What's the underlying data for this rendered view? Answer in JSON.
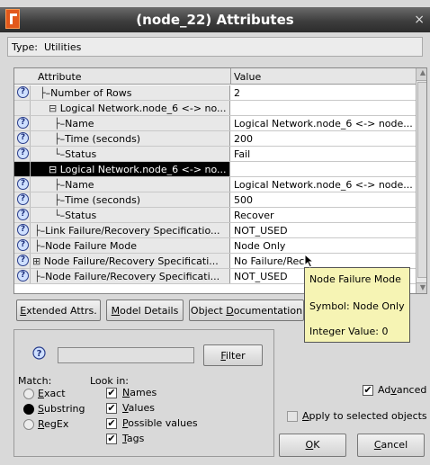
{
  "window": {
    "title": "(node_22) Attributes",
    "close": "×"
  },
  "typebar": {
    "label": "Type:",
    "value": "Utilities"
  },
  "table": {
    "headers": {
      "attribute": "Attribute",
      "value": "Value"
    },
    "rows": [
      {
        "attr": "Number of Rows",
        "prefix": "├",
        "value": "2"
      },
      {
        "attr": "Logical Network.node_6 <-> no...",
        "prefix": "⊟",
        "value": ""
      },
      {
        "attr": "Name",
        "prefix": "├",
        "value": "Logical Network.node_6 <-> node..."
      },
      {
        "attr": "Time (seconds)",
        "prefix": "├",
        "value": "200"
      },
      {
        "attr": "Status",
        "prefix": "└",
        "value": "Fail"
      },
      {
        "attr": "Logical Network.node_6 <-> no...",
        "prefix": "⊟",
        "value": ""
      },
      {
        "attr": "Name",
        "prefix": "├",
        "value": "Logical Network.node_6 <-> node..."
      },
      {
        "attr": "Time (seconds)",
        "prefix": "├",
        "value": "500"
      },
      {
        "attr": "Status",
        "prefix": "└",
        "value": "Recover"
      },
      {
        "attr": "Link Failure/Recovery Specificatio...",
        "prefix": "├",
        "value": "NOT_USED"
      },
      {
        "attr": "Node Failure Mode",
        "prefix": "├",
        "value": "Node Only"
      },
      {
        "attr": "Node Failure/Recovery Specificati...",
        "prefix": "⊞",
        "value": "No Failure/Rec"
      },
      {
        "attr": "Node Failure/Recovery Specificati...",
        "prefix": "├",
        "value": "NOT_USED"
      }
    ]
  },
  "buttons": {
    "extended": {
      "pre": "",
      "u": "E",
      "post": "xtended Attrs."
    },
    "model": {
      "pre": "",
      "u": "M",
      "post": "odel Details"
    },
    "objdoc": {
      "pre": "Object ",
      "u": "D",
      "post": "ocumentation"
    }
  },
  "tooltip": {
    "line1": "Node Failure Mode",
    "line2": "Symbol: Node Only",
    "line3": "Integer Value: 0"
  },
  "filter": {
    "input_value": "",
    "button": {
      "u": "F",
      "post": "ilter"
    },
    "match_label": "Match:",
    "lookin_label": "Look in:",
    "match_options": [
      {
        "u": "E",
        "post": "xact",
        "selected": false
      },
      {
        "u": "S",
        "post": "ubstring",
        "selected": true
      },
      {
        "u": "R",
        "post": "egEx",
        "selected": false
      }
    ],
    "lookin_options": [
      {
        "u": "N",
        "post": "ames",
        "checked": true
      },
      {
        "u": "V",
        "post": "alues",
        "checked": true,
        "pre": ""
      },
      {
        "u": "P",
        "post": "ossible values",
        "checked": true
      },
      {
        "u": "T",
        "post": "ags",
        "checked": true
      }
    ]
  },
  "advanced": {
    "pre": "Ad",
    "u": "v",
    "post": "anced",
    "checked": true
  },
  "apply": {
    "u": "A",
    "post": "pply to selected objects",
    "checked": false
  },
  "ok": {
    "u": "O",
    "post": "K"
  },
  "cancel": {
    "u": "C",
    "post": "ancel"
  }
}
